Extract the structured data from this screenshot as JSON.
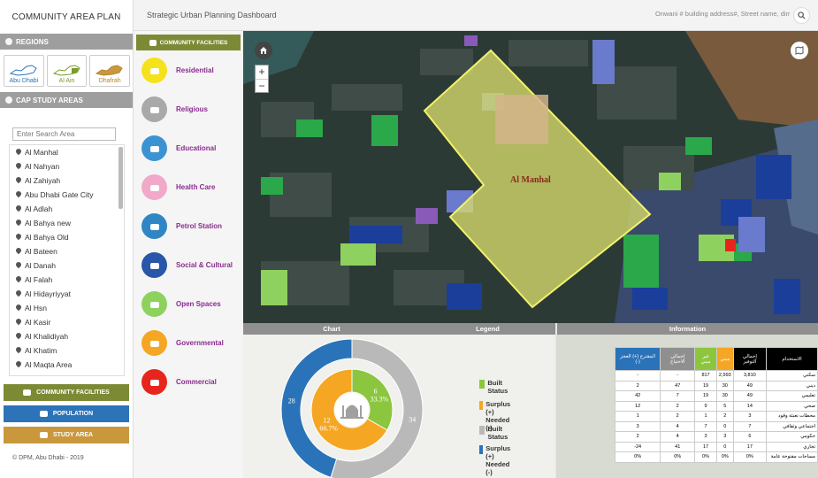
{
  "app": {
    "title": "COMMUNITY AREA PLAN",
    "dashboard_title": "Strategic Urban Planning Dashboard",
    "address_placeholder": "Onwani # building address#, Street name, dime",
    "copyright": "© DPM, Abu Dhabi - 2019"
  },
  "sidebar": {
    "regions_header": "REGIONS",
    "regions": [
      {
        "label": "Abu Dhabi",
        "color": "#2a73b8"
      },
      {
        "label": "Al Ain",
        "color": "#7a9a2a"
      },
      {
        "label": "Dhafrah",
        "color": "#b7862b"
      }
    ],
    "study_header": "CAP STUDY AREAS",
    "search_placeholder": "Enter Search Area",
    "areas": [
      "Al Manhal",
      "Al Nahyan",
      "Al Zahiyah",
      "Abu Dhabi Gate City",
      "Al Adlah",
      "Al Bahya new",
      "Al Bahya Old",
      "Al Bateen",
      "Al Danah",
      "Al Falah",
      "Al Hidayriyyat",
      "Al Hsn",
      "Al Kasir",
      "Al Khalidiyah",
      "Al Khatim",
      "Al Maqta Area"
    ],
    "buttons": {
      "community_facilities": "COMMUNITY FACILITIES",
      "population": "POPULATION",
      "study_area": "STUDY AREA"
    }
  },
  "facilities": {
    "header": "COMMUNITY FACILITIES",
    "items": [
      {
        "label": "Residential",
        "color": "#f5e21a",
        "icon": "residential-icon"
      },
      {
        "label": "Religious",
        "color": "#a9a9a9",
        "icon": "mosque-icon"
      },
      {
        "label": "Educational",
        "color": "#3b93d3",
        "icon": "book-icon"
      },
      {
        "label": "Health Care",
        "color": "#f2a8c8",
        "icon": "stethoscope-icon"
      },
      {
        "label": "Petrol Station",
        "color": "#2f86c4",
        "icon": "fuel-icon"
      },
      {
        "label": "Social & Cultural",
        "color": "#2856a8",
        "icon": "people-icon"
      },
      {
        "label": "Open Spaces",
        "color": "#8fd15e",
        "icon": "park-icon"
      },
      {
        "label": "Governmental",
        "color": "#f5a623",
        "icon": "government-icon"
      },
      {
        "label": "Commercial",
        "color": "#e8251d",
        "icon": "shopping-bag-icon"
      }
    ]
  },
  "map": {
    "area_label": "Al Manhal"
  },
  "panels": {
    "chart_header": "Chart",
    "legend_header": "Legend",
    "info_header": "Information",
    "legend": [
      {
        "label": "Built Status",
        "color": "#8cc63f"
      },
      {
        "label": "Surplus (+) Needed (-)",
        "color": "#f5a623"
      },
      {
        "label": "Built Status",
        "color": "#b9b9b9"
      },
      {
        "label": "Surplus (+) Needed (-)",
        "color": "#2a73b8"
      }
    ],
    "table": {
      "headers": [
        {
          "text": "المقترح (+) العجز (-)",
          "color": "#2a73b8"
        },
        {
          "text": "إجمالي الاحتياج",
          "color": "#8f8f8f"
        },
        {
          "text": "غير مبني",
          "color": "#8cc63f"
        },
        {
          "text": "مبني",
          "color": "#f5a623"
        },
        {
          "text": "إجمالي التوفير",
          "color": "#000000"
        },
        {
          "text": "الاستخدام",
          "color": "#000000"
        }
      ],
      "rows": [
        {
          "label": "سكني",
          "cells": [
            "-",
            "-",
            "817",
            "2,993",
            "3,810"
          ]
        },
        {
          "label": "ديني",
          "cells": [
            "2",
            "47",
            "19",
            "30",
            "49"
          ]
        },
        {
          "label": "تعليمي",
          "cells": [
            "42",
            "7",
            "19",
            "30",
            "49"
          ]
        },
        {
          "label": "صحي",
          "cells": [
            "12",
            "2",
            "9",
            "5",
            "14"
          ]
        },
        {
          "label": "محطات تعبئة وقود",
          "cells": [
            "1",
            "2",
            "1",
            "2",
            "3"
          ]
        },
        {
          "label": "اجتماعي وثقافي",
          "cells": [
            "3",
            "4",
            "7",
            "0",
            "7"
          ]
        },
        {
          "label": "حكومي",
          "cells": [
            "2",
            "4",
            "3",
            "3",
            "6"
          ]
        },
        {
          "label": "تجاري",
          "cells": [
            "-24",
            "41",
            "17",
            "0",
            "17"
          ]
        },
        {
          "label": "مساحات مفتوحة عامة",
          "cells": [
            "0%",
            "0%",
            "0%",
            "0%",
            "0%"
          ]
        }
      ]
    }
  },
  "chart_data": {
    "type": "pie",
    "rings": [
      {
        "name": "inner",
        "slices": [
          {
            "value": 6,
            "label": "33.3%",
            "color": "#8cc63f"
          },
          {
            "value": 12,
            "label": "66.7%",
            "color": "#f5a623"
          }
        ]
      },
      {
        "name": "outer",
        "slices": [
          {
            "value": 34,
            "color": "#b9b9b9"
          },
          {
            "value": 28,
            "color": "#2a73b8"
          }
        ]
      }
    ]
  }
}
